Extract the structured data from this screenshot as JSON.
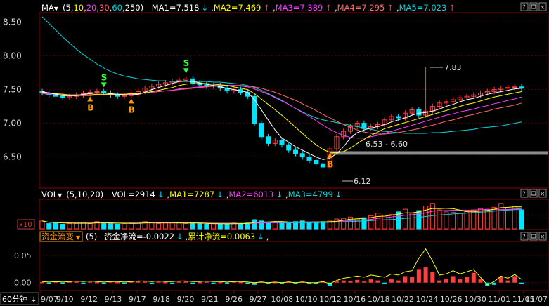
{
  "colors": {
    "background": "#000000",
    "frame": "#8b0000",
    "grid": "#5a0000",
    "axis_text": "#d7d7d7",
    "up": "#ff4040",
    "down": "#00e5ff",
    "ma1": "#ffffff",
    "ma2": "#ffff00",
    "ma3": "#ff3cff",
    "ma4": "#ff6a6a",
    "ma5": "#00d7d7",
    "buy_marker": "#ff9900",
    "sell_marker": "#33ff33",
    "flow_cum": "#ffff00"
  },
  "price_panel": {
    "label": "MA",
    "params_open": "(",
    "params": [
      "5",
      "10",
      "20",
      "30",
      "60",
      "250"
    ],
    "params_close": ")",
    "legend": [
      {
        "text": "MA1=7.518",
        "arrow": "↓",
        "color_key": "ma1"
      },
      {
        "text": "MA2=7.469",
        "arrow": "↑",
        "color_key": "ma2"
      },
      {
        "text": "MA3=7.389",
        "arrow": "↑",
        "color_key": "ma3"
      },
      {
        "text": "MA4=7.295",
        "arrow": "↑",
        "color_key": "ma4"
      },
      {
        "text": "MA5=7.023",
        "arrow": "↑",
        "color_key": "ma5"
      }
    ],
    "annotations": {
      "high": "7.83",
      "low": "6.12",
      "range": "6.53 - 6.60"
    },
    "signals": [
      {
        "type": "B",
        "x": 7
      },
      {
        "type": "S",
        "x": 9
      },
      {
        "type": "B",
        "x": 13
      },
      {
        "type": "S",
        "x": 21
      },
      {
        "type": "B",
        "x": 42
      }
    ]
  },
  "volume_panel": {
    "label": "VOL",
    "params": "(5,10,20)",
    "legend": [
      {
        "text": "VOL=2914",
        "arrow": "↓",
        "color_key": "ma1"
      },
      {
        "text": "MA1=7287",
        "arrow": "↓",
        "color_key": "ma2"
      },
      {
        "text": "MA2=6013",
        "arrow": "↓",
        "color_key": "ma3"
      },
      {
        "text": "MA3=4799",
        "arrow": "↓",
        "color_key": "ma5"
      }
    ],
    "scale_label": "x10"
  },
  "flow_panel": {
    "label": "资金流变",
    "params": "(5)",
    "legend": [
      {
        "text": "资金净流=-0.0022",
        "arrow": "↓",
        "color_key": "ma1"
      },
      {
        "text": "累计净流=0.0063",
        "arrow": "↓",
        "color_key": "ma2"
      }
    ],
    "tail": ","
  },
  "period_button": "60分钟",
  "chart_data": [
    {
      "type": "candlestick",
      "title": "",
      "x_labels": [
        "9/07",
        "9/10",
        "9/12",
        "9/13",
        "9/17",
        "9/18",
        "9/20",
        "9/21",
        "9/26",
        "9/27",
        "10/08",
        "10/10",
        "10/12",
        "10/16",
        "10/18",
        "10/22",
        "10/24",
        "10/26",
        "10/30",
        "11/01",
        "11/05",
        "11/07"
      ],
      "y_ticks": [
        "8.50",
        "8.00",
        "7.50",
        "7.00",
        "6.50"
      ],
      "ylim": [
        6.1,
        8.6
      ],
      "x": [
        0,
        1,
        2,
        3,
        4,
        5,
        6,
        7,
        8,
        9,
        10,
        11,
        12,
        13,
        14,
        15,
        16,
        17,
        18,
        19,
        20,
        21,
        22,
        23,
        24,
        25,
        26,
        27,
        28,
        29,
        30,
        31,
        32,
        33,
        34,
        35,
        36,
        37,
        38,
        39,
        40,
        41,
        42,
        43,
        44,
        45,
        46,
        47,
        48,
        49,
        50,
        51,
        52,
        53,
        54,
        55,
        56,
        57,
        58,
        59,
        60,
        61,
        62,
        63,
        64,
        65,
        66,
        67,
        68,
        69,
        70
      ],
      "close": [
        7.45,
        7.42,
        7.4,
        7.38,
        7.4,
        7.42,
        7.44,
        7.46,
        7.47,
        7.45,
        7.42,
        7.4,
        7.41,
        7.43,
        7.47,
        7.52,
        7.55,
        7.58,
        7.6,
        7.62,
        7.64,
        7.66,
        7.6,
        7.57,
        7.55,
        7.56,
        7.52,
        7.48,
        7.5,
        7.46,
        7.4,
        7.0,
        6.8,
        6.7,
        6.75,
        6.68,
        6.6,
        6.55,
        6.5,
        6.45,
        6.4,
        6.35,
        6.62,
        6.8,
        6.88,
        6.95,
        7.0,
        6.92,
        6.95,
        6.98,
        7.05,
        7.1,
        7.08,
        7.15,
        7.2,
        7.12,
        7.18,
        7.25,
        7.3,
        7.32,
        7.35,
        7.38,
        7.4,
        7.42,
        7.45,
        7.47,
        7.5,
        7.52,
        7.53,
        7.54,
        7.52
      ],
      "ma5": [
        7.47,
        7.45,
        7.43,
        7.41,
        7.41,
        7.41,
        7.43,
        7.44,
        7.45,
        7.45,
        7.44,
        7.43,
        7.42,
        7.42,
        7.43,
        7.46,
        7.5,
        7.53,
        7.56,
        7.59,
        7.62,
        7.63,
        7.62,
        7.6,
        7.58,
        7.56,
        7.54,
        7.52,
        7.5,
        7.48,
        7.46,
        7.35,
        7.2,
        7.05,
        6.9,
        6.78,
        6.72,
        6.65,
        6.6,
        6.55,
        6.5,
        6.46,
        6.48,
        6.55,
        6.65,
        6.78,
        6.86,
        6.9,
        6.93,
        6.95,
        6.98,
        7.02,
        7.05,
        7.08,
        7.12,
        7.15,
        7.16,
        7.18,
        7.21,
        7.25,
        7.28,
        7.32,
        7.35,
        7.37,
        7.4,
        7.43,
        7.45,
        7.47,
        7.49,
        7.51,
        7.52
      ],
      "ma10": [
        7.46,
        7.45,
        7.44,
        7.43,
        7.42,
        7.42,
        7.42,
        7.42,
        7.43,
        7.43,
        7.43,
        7.43,
        7.43,
        7.44,
        7.44,
        7.45,
        7.47,
        7.49,
        7.51,
        7.53,
        7.56,
        7.58,
        7.59,
        7.59,
        7.59,
        7.58,
        7.57,
        7.56,
        7.54,
        7.52,
        7.5,
        7.44,
        7.36,
        7.28,
        7.2,
        7.12,
        7.03,
        6.94,
        6.85,
        6.76,
        6.68,
        6.61,
        6.57,
        6.56,
        6.58,
        6.63,
        6.7,
        6.76,
        6.82,
        6.87,
        6.92,
        6.95,
        6.98,
        7.01,
        7.04,
        7.07,
        7.1,
        7.13,
        7.16,
        7.19,
        7.22,
        7.25,
        7.28,
        7.3,
        7.33,
        7.36,
        7.39,
        7.41,
        7.43,
        7.45,
        7.47
      ],
      "ma20": [
        7.44,
        7.44,
        7.43,
        7.43,
        7.42,
        7.42,
        7.42,
        7.42,
        7.42,
        7.42,
        7.42,
        7.42,
        7.43,
        7.43,
        7.44,
        7.45,
        7.46,
        7.47,
        7.48,
        7.49,
        7.51,
        7.52,
        7.53,
        7.54,
        7.55,
        7.56,
        7.56,
        7.56,
        7.56,
        7.55,
        7.54,
        7.51,
        7.47,
        7.43,
        7.38,
        7.33,
        7.28,
        7.22,
        7.16,
        7.1,
        7.04,
        6.97,
        6.91,
        6.86,
        6.82,
        6.79,
        6.78,
        6.78,
        6.8,
        6.82,
        6.85,
        6.88,
        6.91,
        6.94,
        6.97,
        7.0,
        7.03,
        7.06,
        7.09,
        7.12,
        7.14,
        7.17,
        7.19,
        7.21,
        7.24,
        7.26,
        7.29,
        7.31,
        7.34,
        7.36,
        7.39
      ],
      "ma30": [
        7.42,
        7.42,
        7.42,
        7.41,
        7.41,
        7.41,
        7.41,
        7.41,
        7.42,
        7.42,
        7.42,
        7.43,
        7.43,
        7.44,
        7.44,
        7.45,
        7.46,
        7.47,
        7.48,
        7.49,
        7.5,
        7.51,
        7.52,
        7.53,
        7.54,
        7.55,
        7.55,
        7.56,
        7.56,
        7.56,
        7.55,
        7.54,
        7.52,
        7.49,
        7.46,
        7.42,
        7.38,
        7.34,
        7.29,
        7.24,
        7.19,
        7.13,
        7.08,
        7.03,
        6.98,
        6.94,
        6.9,
        6.87,
        6.85,
        6.84,
        6.84,
        6.85,
        6.86,
        6.88,
        6.9,
        6.92,
        6.95,
        6.97,
        7.0,
        7.03,
        7.05,
        7.08,
        7.11,
        7.13,
        7.16,
        7.18,
        7.21,
        7.23,
        7.25,
        7.27,
        7.3
      ],
      "ma60": [
        8.58,
        8.48,
        8.38,
        8.28,
        8.19,
        8.1,
        8.02,
        7.95,
        7.88,
        7.82,
        7.77,
        7.73,
        7.7,
        7.68,
        7.66,
        7.65,
        7.64,
        7.63,
        7.63,
        7.62,
        7.62,
        7.62,
        7.62,
        7.62,
        7.62,
        7.61,
        7.61,
        7.6,
        7.59,
        7.58,
        7.56,
        7.53,
        7.49,
        7.44,
        7.39,
        7.34,
        7.28,
        7.22,
        7.17,
        7.12,
        7.08,
        7.05,
        7.03,
        7.01,
        6.99,
        6.97,
        6.95,
        6.93,
        6.91,
        6.89,
        6.88,
        6.87,
        6.86,
        6.85,
        6.85,
        6.85,
        6.85,
        6.86,
        6.86,
        6.87,
        6.88,
        6.89,
        6.9,
        6.91,
        6.93,
        6.94,
        6.95,
        6.96,
        6.98,
        7.0,
        7.02
      ]
    },
    {
      "type": "bar",
      "title": "",
      "values": [
        1.2,
        0.8,
        0.9,
        0.7,
        0.8,
        1.0,
        0.9,
        0.8,
        1.1,
        0.9,
        0.8,
        0.7,
        0.8,
        0.9,
        1.0,
        1.1,
        0.9,
        0.8,
        0.9,
        1.0,
        0.9,
        0.8,
        0.9,
        0.8,
        0.7,
        0.8,
        0.7,
        0.8,
        0.9,
        0.8,
        0.9,
        1.4,
        1.2,
        1.0,
        1.1,
        0.9,
        1.0,
        1.1,
        1.2,
        0.9,
        1.0,
        1.1,
        1.3,
        1.5,
        1.6,
        1.8,
        1.5,
        1.7,
        2.0,
        2.4,
        2.1,
        2.2,
        2.6,
        3.0,
        2.4,
        2.8,
        3.5,
        3.9,
        2.9,
        2.6,
        2.5,
        2.4,
        2.7,
        2.9,
        3.1,
        3.0,
        3.3,
        3.9,
        3.2,
        3.5,
        2.9
      ],
      "ylim": [
        0,
        4.2
      ]
    },
    {
      "type": "bar",
      "title": "",
      "y_ticks": [
        "0.05",
        "0.00"
      ],
      "values": [
        0.001,
        -0.001,
        0.002,
        -0.001,
        0.002,
        0.003,
        -0.002,
        0.002,
        0.001,
        -0.003,
        0.002,
        0.001,
        -0.002,
        0.002,
        0.003,
        0.002,
        -0.001,
        0.002,
        0.001,
        -0.001,
        0.002,
        0.003,
        -0.002,
        0.001,
        0.002,
        -0.001,
        0.001,
        -0.002,
        0.002,
        0.001,
        -0.003,
        -0.004,
        0.002,
        -0.002,
        0.001,
        -0.002,
        0.002,
        -0.003,
        0.002,
        -0.002,
        -0.003,
        0.003,
        -0.006,
        0.002,
        0.004,
        0.003,
        0.005,
        0.002,
        0.006,
        0.004,
        -0.002,
        0.006,
        0.004,
        0.012,
        0.01,
        0.025,
        0.028,
        0.02,
        0.004,
        0.006,
        0.012,
        0.006,
        0.01,
        0.018,
        0.006,
        -0.006,
        -0.004,
        0.01,
        0.004,
        0.012,
        -0.002
      ],
      "cum": [
        0.002,
        0.001,
        0.002,
        0.001,
        0.002,
        0.003,
        0.002,
        0.003,
        0.002,
        0.001,
        0.002,
        0.002,
        0.001,
        0.002,
        0.003,
        0.003,
        0.002,
        0.003,
        0.002,
        0.002,
        0.003,
        0.003,
        0.002,
        0.002,
        0.003,
        0.002,
        0.002,
        0.001,
        0.002,
        0.002,
        0.001,
        0.0,
        0.001,
        0.0,
        0.001,
        0.0,
        0.001,
        0.0,
        0.001,
        0.0,
        0.0,
        0.002,
        -0.002,
        0.004,
        0.008,
        0.01,
        0.012,
        0.01,
        0.014,
        0.012,
        0.01,
        0.016,
        0.014,
        0.02,
        0.022,
        0.045,
        0.062,
        0.04,
        0.014,
        0.016,
        0.022,
        0.016,
        0.02,
        0.024,
        0.01,
        -0.004,
        0.002,
        0.012,
        0.008,
        0.015,
        0.006
      ],
      "ylim": [
        -0.012,
        0.072
      ]
    }
  ]
}
